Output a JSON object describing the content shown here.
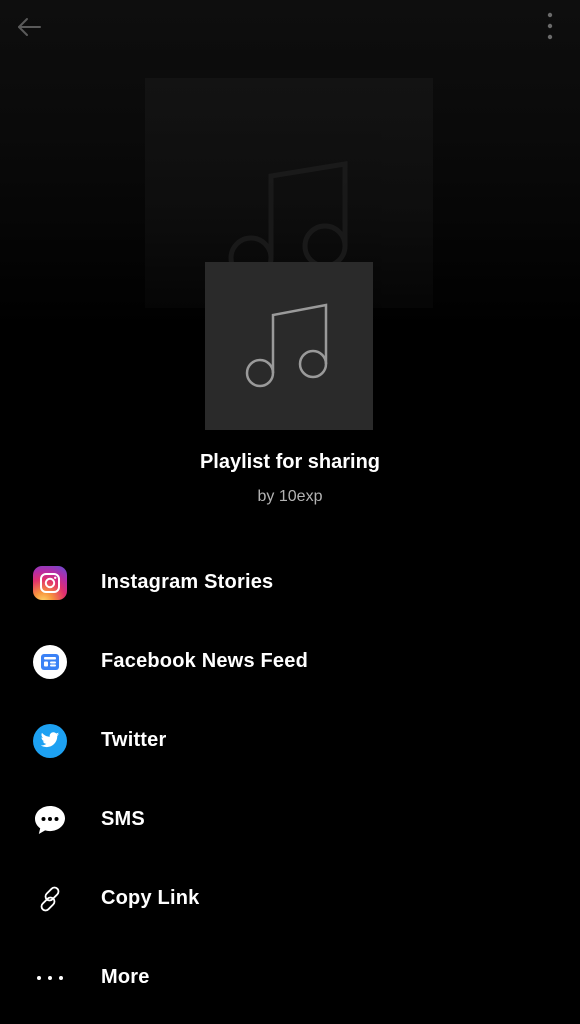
{
  "header": {
    "back_icon": "arrow-left-icon",
    "menu_icon": "more-vertical-icon"
  },
  "playlist": {
    "title": "Playlist for sharing",
    "subtitle": "by 10exp",
    "art_icon": "music-note-icon"
  },
  "share_options": [
    {
      "label": "Instagram Stories",
      "icon": "instagram-icon"
    },
    {
      "label": "Facebook News Feed",
      "icon": "facebook-news-feed-icon"
    },
    {
      "label": "Twitter",
      "icon": "twitter-icon"
    },
    {
      "label": "SMS",
      "icon": "sms-bubble-icon"
    },
    {
      "label": "Copy Link",
      "icon": "link-icon"
    },
    {
      "label": "More",
      "icon": "more-horizontal-icon"
    }
  ],
  "colors": {
    "background": "#000000",
    "cover": "#2a2a2a",
    "subtitle": "#b3b3b3",
    "twitter": "#1da1f2"
  }
}
